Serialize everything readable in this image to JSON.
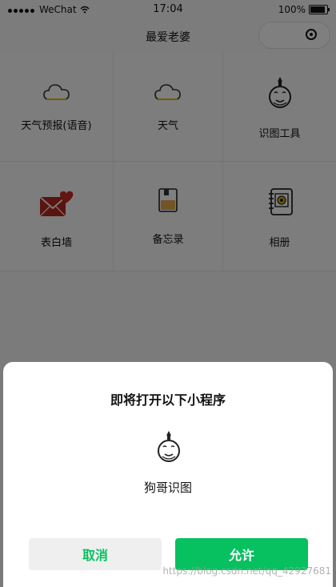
{
  "statusbar": {
    "carrier": "WeChat",
    "time": "17:04",
    "battery": "100%"
  },
  "navbar": {
    "title": "最爱老婆"
  },
  "grid": {
    "items": [
      {
        "label": "天气预报(语音)",
        "icon": "cloud-icon"
      },
      {
        "label": "天气",
        "icon": "cloud-icon"
      },
      {
        "label": "识图工具",
        "icon": "mascot-face-icon"
      },
      {
        "label": "表白墙",
        "icon": "love-letter-icon"
      },
      {
        "label": "备忘录",
        "icon": "memo-book-icon"
      },
      {
        "label": "相册",
        "icon": "album-icon"
      }
    ]
  },
  "dialog": {
    "title": "即将打开以下小程序",
    "app_name": "狗哥识图",
    "cancel_label": "取消",
    "allow_label": "允许"
  },
  "watermark": "https://blog.csdn.net/qq_42927681",
  "colors": {
    "accent": "#07c160",
    "overlay": "rgba(0,0,0,0.5)"
  }
}
